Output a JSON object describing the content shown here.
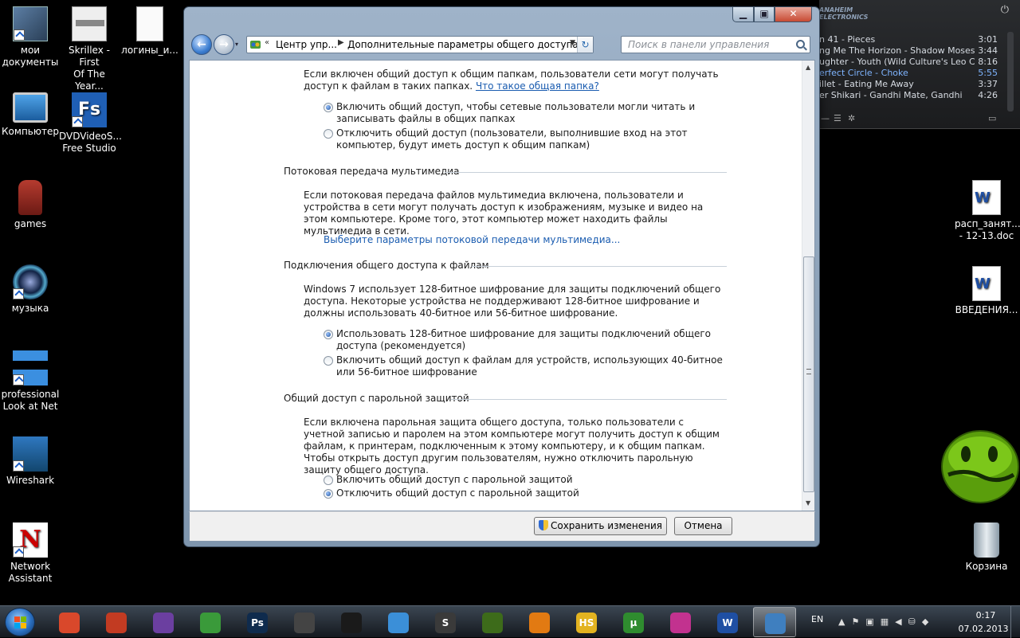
{
  "desktop": {
    "left_icons": [
      {
        "name": "my-documents",
        "label": "мои\nдокументы"
      },
      {
        "name": "skrillex",
        "label": "Skrillex - First\nOf The Year..."
      },
      {
        "name": "logins",
        "label": "логины_и..."
      },
      {
        "name": "computer",
        "label": "Компьютер"
      },
      {
        "name": "dvdvideosoft",
        "label": "DVDVideoS...\nFree Studio"
      },
      {
        "name": "games",
        "label": "games"
      },
      {
        "name": "music",
        "label": "музыка"
      },
      {
        "name": "professional-look-at-net",
        "label": "professional\nLook at Net"
      },
      {
        "name": "wireshark",
        "label": "Wireshark"
      },
      {
        "name": "network-assistant",
        "label": "Network\nAssistant"
      }
    ],
    "right_icons": [
      {
        "name": "rasp-doc",
        "label": "расп_занят...\n- 12-13.doc"
      },
      {
        "name": "vvedenie-doc",
        "label": "ВВЕДЕНИЯ..."
      },
      {
        "name": "recycle-bin",
        "label": "Корзина"
      }
    ]
  },
  "player": {
    "brand": "ANAHEIM\nELECTRONICS",
    "tracks": [
      {
        "title": "n 41 - Pieces",
        "duration": "3:01"
      },
      {
        "title": "ng Me The Horizon - Shadow Moses",
        "duration": "3:44"
      },
      {
        "title": "ughter - Youth (Wild Culture's Leo Craz...",
        "duration": "8:16"
      },
      {
        "title": "erfect Circle - Choke",
        "duration": "5:55"
      },
      {
        "title": "illet - Eating Me Away",
        "duration": "3:37"
      },
      {
        "title": "er Shikari - Gandhi Mate, Gandhi",
        "duration": "4:26"
      }
    ]
  },
  "window": {
    "breadcrumb": [
      "Центр упр...",
      "Дополнительные параметры общего доступа"
    ],
    "search_placeholder": "Поиск в панели управления",
    "folder_sharing": {
      "text": "Если включен общий доступ к общим папкам, пользователи сети могут получать доступ к файлам в таких папках.",
      "link": "Что такое общая папка?",
      "options": [
        {
          "label": "Включить общий доступ, чтобы сетевые пользователи могли читать и записывать файлы в общих папках",
          "checked": true
        },
        {
          "label": "Отключить общий доступ (пользователи, выполнившие вход на этот компьютер, будут иметь доступ к общим папкам)",
          "checked": false
        }
      ]
    },
    "media_streaming": {
      "heading": "Потоковая передача мультимедиа",
      "text": "Если потоковая передача файлов мультимедиа включена, пользователи и устройства в сети могут получать доступ к изображениям, музыке и видео на этом компьютере. Кроме того, этот компьютер может находить файлы мультимедиа в сети.",
      "link": "Выберите параметры потоковой передачи мультимедиа..."
    },
    "file_sharing_connections": {
      "heading": "Подключения общего доступа к файлам",
      "text": "Windows 7 использует 128-битное шифрование для защиты подключений общего доступа. Некоторые устройства не поддерживают 128-битное шифрование и должны использовать 40-битное или 56-битное шифрование.",
      "options": [
        {
          "label": "Использовать 128-битное шифрование для защиты подключений общего доступа (рекомендуется)",
          "checked": true
        },
        {
          "label": "Включить общий доступ к файлам для устройств, использующих 40-битное или 56-битное шифрование",
          "checked": false
        }
      ]
    },
    "password_protected": {
      "heading": "Общий доступ с парольной защитой",
      "text": "Если включена парольная защита общего доступа, только пользователи с учетной записью и паролем на этом компьютере могут получить доступ к общим файлам, к принтерам, подключенным к этому компьютеру, и к общим папкам. Чтобы открыть доступ другим пользователям, нужно отключить парольную защиту общего доступа.",
      "options": [
        {
          "label": "Включить общий доступ с парольной защитой",
          "checked": false
        },
        {
          "label": "Отключить общий доступ с парольной защитой",
          "checked": true
        }
      ]
    },
    "save_label": "Сохранить изменения",
    "cancel_label": "Отмена"
  },
  "taskbar": {
    "apps": [
      {
        "name": "chrome",
        "color": "#d9482b",
        "glyph": "",
        "active": false
      },
      {
        "name": "ccleaner",
        "color": "#c23b22",
        "glyph": "",
        "active": false
      },
      {
        "name": "visual-studio",
        "color": "#6b3fa0",
        "glyph": "",
        "active": false
      },
      {
        "name": "map-app",
        "color": "#3a9a3a",
        "glyph": "",
        "active": false
      },
      {
        "name": "photoshop",
        "color": "#0f2b4d",
        "glyph": "Ps",
        "active": false
      },
      {
        "name": "winamp",
        "color": "#444",
        "glyph": "",
        "active": false
      },
      {
        "name": "razer",
        "color": "#1a1a1a",
        "glyph": "",
        "active": false
      },
      {
        "name": "music-editor",
        "color": "#3b8fd8",
        "glyph": "",
        "active": false
      },
      {
        "name": "sublime",
        "color": "#3a3a3a",
        "glyph": "S",
        "active": false
      },
      {
        "name": "plant-game",
        "color": "#3d6b1a",
        "glyph": "",
        "active": false
      },
      {
        "name": "vlc",
        "color": "#e27a12",
        "glyph": "",
        "active": false
      },
      {
        "name": "hotspot",
        "color": "#e3b320",
        "glyph": "HS",
        "active": false
      },
      {
        "name": "utorrent",
        "color": "#2f8c2f",
        "glyph": "µ",
        "active": false
      },
      {
        "name": "pink-app",
        "color": "#c2328f",
        "glyph": "",
        "active": false
      },
      {
        "name": "word",
        "color": "#1f4fa3",
        "glyph": "W",
        "active": false
      },
      {
        "name": "control-panel",
        "color": "#3f7fbf",
        "glyph": "",
        "active": true
      }
    ],
    "lang": "EN",
    "time": "0:17",
    "date": "07.02.2013"
  }
}
